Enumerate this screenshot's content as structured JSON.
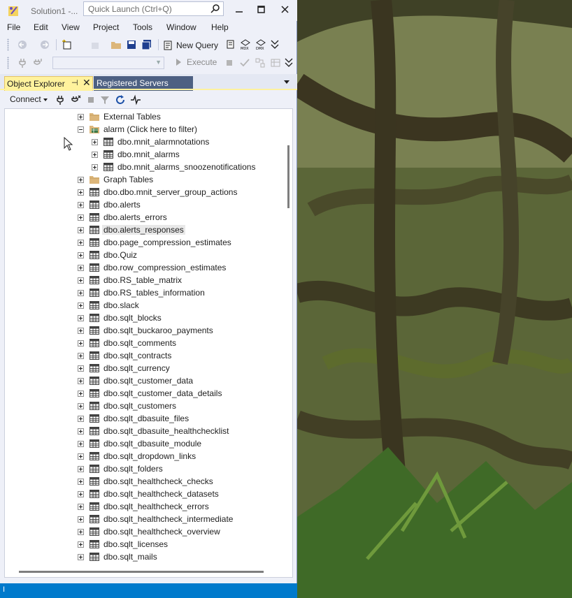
{
  "window": {
    "title": "Solution1 -...",
    "quick_launch_placeholder": "Quick Launch (Ctrl+Q)"
  },
  "menu": [
    "File",
    "Edit",
    "View",
    "Project",
    "Tools",
    "Window",
    "Help"
  ],
  "toolbar": {
    "new_query_label": "New Query",
    "execute_label": "Execute"
  },
  "tabs": {
    "object_explorer": "Object Explorer",
    "registered_servers": "Registered Servers"
  },
  "object_explorer": {
    "connect_label": "Connect"
  },
  "tree": {
    "rows": [
      {
        "label": "External Tables",
        "type": "folder",
        "depth": 1,
        "expander": "plus"
      },
      {
        "label": "alarm (Click here to filter)",
        "type": "schema-folder",
        "depth": 1,
        "expander": "minus"
      },
      {
        "label": "dbo.mnit_alarmnotations",
        "type": "table",
        "depth": 2,
        "expander": "plus"
      },
      {
        "label": "dbo.mnit_alarms",
        "type": "table",
        "depth": 2,
        "expander": "plus"
      },
      {
        "label": "dbo.mnit_alarms_snoozenotifications",
        "type": "table",
        "depth": 2,
        "expander": "plus"
      },
      {
        "label": "Graph Tables",
        "type": "folder",
        "depth": 1,
        "expander": "plus"
      },
      {
        "label": "dbo.dbo.mnit_server_group_actions",
        "type": "table",
        "depth": 1,
        "expander": "plus"
      },
      {
        "label": "dbo.alerts",
        "type": "table",
        "depth": 1,
        "expander": "plus"
      },
      {
        "label": "dbo.alerts_errors",
        "type": "table",
        "depth": 1,
        "expander": "plus"
      },
      {
        "label": "dbo.alerts_responses",
        "type": "table",
        "depth": 1,
        "expander": "plus",
        "selected": true
      },
      {
        "label": "dbo.page_compression_estimates",
        "type": "table",
        "depth": 1,
        "expander": "plus"
      },
      {
        "label": "dbo.Quiz",
        "type": "table",
        "depth": 1,
        "expander": "plus"
      },
      {
        "label": "dbo.row_compression_estimates",
        "type": "table",
        "depth": 1,
        "expander": "plus"
      },
      {
        "label": "dbo.RS_table_matrix",
        "type": "table",
        "depth": 1,
        "expander": "plus"
      },
      {
        "label": "dbo.RS_tables_information",
        "type": "table",
        "depth": 1,
        "expander": "plus"
      },
      {
        "label": "dbo.slack",
        "type": "table",
        "depth": 1,
        "expander": "plus"
      },
      {
        "label": "dbo.sqlt_blocks",
        "type": "table",
        "depth": 1,
        "expander": "plus"
      },
      {
        "label": "dbo.sqlt_buckaroo_payments",
        "type": "table",
        "depth": 1,
        "expander": "plus"
      },
      {
        "label": "dbo.sqlt_comments",
        "type": "table",
        "depth": 1,
        "expander": "plus"
      },
      {
        "label": "dbo.sqlt_contracts",
        "type": "table",
        "depth": 1,
        "expander": "plus"
      },
      {
        "label": "dbo.sqlt_currency",
        "type": "table",
        "depth": 1,
        "expander": "plus"
      },
      {
        "label": "dbo.sqlt_customer_data",
        "type": "table",
        "depth": 1,
        "expander": "plus"
      },
      {
        "label": "dbo.sqlt_customer_data_details",
        "type": "table",
        "depth": 1,
        "expander": "plus"
      },
      {
        "label": "dbo.sqlt_customers",
        "type": "table",
        "depth": 1,
        "expander": "plus"
      },
      {
        "label": "dbo.sqlt_dbasuite_files",
        "type": "table",
        "depth": 1,
        "expander": "plus"
      },
      {
        "label": "dbo.sqlt_dbasuite_healthchecklist",
        "type": "table",
        "depth": 1,
        "expander": "plus"
      },
      {
        "label": "dbo.sqlt_dbasuite_module",
        "type": "table",
        "depth": 1,
        "expander": "plus"
      },
      {
        "label": "dbo.sqlt_dropdown_links",
        "type": "table",
        "depth": 1,
        "expander": "plus"
      },
      {
        "label": "dbo.sqlt_folders",
        "type": "table",
        "depth": 1,
        "expander": "plus"
      },
      {
        "label": "dbo.sqlt_healthcheck_checks",
        "type": "table",
        "depth": 1,
        "expander": "plus"
      },
      {
        "label": "dbo.sqlt_healthcheck_datasets",
        "type": "table",
        "depth": 1,
        "expander": "plus"
      },
      {
        "label": "dbo.sqlt_healthcheck_errors",
        "type": "table",
        "depth": 1,
        "expander": "plus"
      },
      {
        "label": "dbo.sqlt_healthcheck_intermediate",
        "type": "table",
        "depth": 1,
        "expander": "plus"
      },
      {
        "label": "dbo.sqlt_healthcheck_overview",
        "type": "table",
        "depth": 1,
        "expander": "plus"
      },
      {
        "label": "dbo.sqlt_licenses",
        "type": "table",
        "depth": 1,
        "expander": "plus"
      },
      {
        "label": "dbo.sqlt_mails",
        "type": "table",
        "depth": 1,
        "expander": "plus"
      }
    ]
  },
  "status_bar": {
    "text": "I"
  },
  "colors": {
    "accent_tab": "#fff29d",
    "inactive_tab": "#4d6082",
    "status_bar": "#007acc"
  }
}
